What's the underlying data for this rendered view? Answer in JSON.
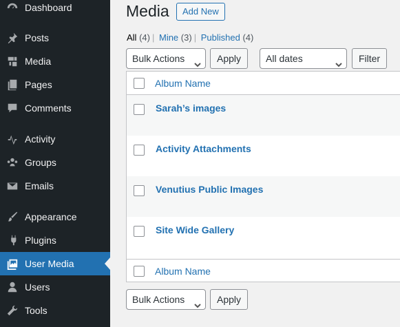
{
  "sidebar": {
    "items": [
      {
        "label": "Dashboard",
        "icon": "dashboard-icon"
      },
      {
        "label": "Posts",
        "icon": "pin-icon"
      },
      {
        "label": "Media",
        "icon": "media-icon"
      },
      {
        "label": "Pages",
        "icon": "pages-icon"
      },
      {
        "label": "Comments",
        "icon": "comment-icon"
      },
      {
        "label": "Activity",
        "icon": "activity-icon"
      },
      {
        "label": "Groups",
        "icon": "groups-icon"
      },
      {
        "label": "Emails",
        "icon": "email-icon"
      },
      {
        "label": "Appearance",
        "icon": "brush-icon"
      },
      {
        "label": "Plugins",
        "icon": "plugin-icon"
      },
      {
        "label": "User Media",
        "icon": "user-media-icon",
        "current": true
      },
      {
        "label": "Users",
        "icon": "user-icon"
      },
      {
        "label": "Tools",
        "icon": "wrench-icon"
      }
    ]
  },
  "header": {
    "title": "Media",
    "add_new_label": "Add New"
  },
  "filters": {
    "all_label": "All",
    "all_count": "(4)",
    "mine_label": "Mine",
    "mine_count": "(3)",
    "published_label": "Published",
    "published_count": "(4)",
    "separator": "|"
  },
  "toolbar": {
    "bulk_actions": "Bulk Actions",
    "apply": "Apply",
    "dates": "All dates",
    "filter": "Filter"
  },
  "table": {
    "column_header": "Album Name",
    "rows": [
      {
        "title": "Sarah’s images"
      },
      {
        "title": "Activity Attachments"
      },
      {
        "title": "Venutius Public Images"
      },
      {
        "title": "Site Wide Gallery"
      }
    ]
  },
  "colors": {
    "sidebar_bg": "#1d2327",
    "accent": "#2271b1",
    "page_bg": "#f1f1f1"
  }
}
